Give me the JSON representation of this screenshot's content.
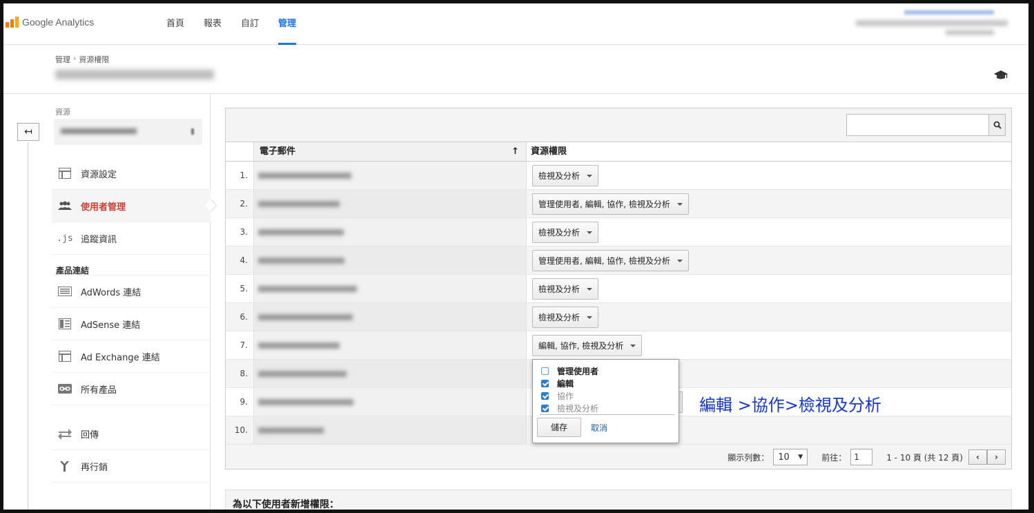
{
  "app": {
    "logo_text": "Google Analytics"
  },
  "nav": {
    "items": [
      {
        "label": "首頁"
      },
      {
        "label": "報表"
      },
      {
        "label": "自訂"
      },
      {
        "label": "管理"
      }
    ],
    "active": "管理"
  },
  "breadcrumb": {
    "items": [
      "管理",
      "資源權限"
    ],
    "separator": "›"
  },
  "sidebar": {
    "resource_label": "資源",
    "items": [
      {
        "label": "資源設定",
        "icon": "layout-box-icon"
      },
      {
        "label": "使用者管理",
        "icon": "users-icon",
        "active": true
      },
      {
        "label": "追蹤資訊",
        "icon": "js-icon"
      }
    ],
    "section_title": "產品連結",
    "product_items": [
      {
        "label": "AdWords 連結",
        "icon": "adwords-icon"
      },
      {
        "label": "AdSense 連結",
        "icon": "adsense-icon"
      },
      {
        "label": "Ad Exchange 連結",
        "icon": "layout-box-icon"
      },
      {
        "label": "所有產品",
        "icon": "link-icon"
      }
    ],
    "extra_items": [
      {
        "label": "回傳",
        "icon": "postback-icon"
      },
      {
        "label": "再行銷",
        "icon": "remarketing-icon"
      }
    ]
  },
  "table": {
    "col_email": "電子郵件",
    "col_perm": "資源權限",
    "sort_indicator": "↑",
    "rows": [
      {
        "num": "1.",
        "perm": "檢視及分析"
      },
      {
        "num": "2.",
        "perm": "管理使用者, 編輯, 協作, 檢視及分析"
      },
      {
        "num": "3.",
        "perm": "檢視及分析"
      },
      {
        "num": "4.",
        "perm": "管理使用者, 編輯, 協作, 檢視及分析"
      },
      {
        "num": "5.",
        "perm": "檢視及分析"
      },
      {
        "num": "6.",
        "perm": "檢視及分析"
      },
      {
        "num": "7.",
        "perm": "編輯, 協作, 檢視及分析"
      },
      {
        "num": "8.",
        "perm": ""
      },
      {
        "num": "9.",
        "perm": ""
      },
      {
        "num": "10.",
        "perm": ""
      }
    ]
  },
  "popup": {
    "options": [
      {
        "label": "管理使用者",
        "checked": false
      },
      {
        "label": "編輯",
        "checked": true
      },
      {
        "label": "協作",
        "checked": true
      },
      {
        "label": "檢視及分析",
        "checked": true
      }
    ],
    "save_label": "儲存",
    "cancel_label": "取消"
  },
  "annotation": "編輯 >協作>檢視及分析",
  "footer": {
    "rows_label": "顯示列數：",
    "rows_value": "10",
    "goto_label": "前往：",
    "goto_value": "1",
    "page_info": "1 - 10 頁 (共 12 頁)",
    "prev": "‹",
    "next": "›"
  },
  "add_section": {
    "title": "為以下使用者新增權限："
  }
}
